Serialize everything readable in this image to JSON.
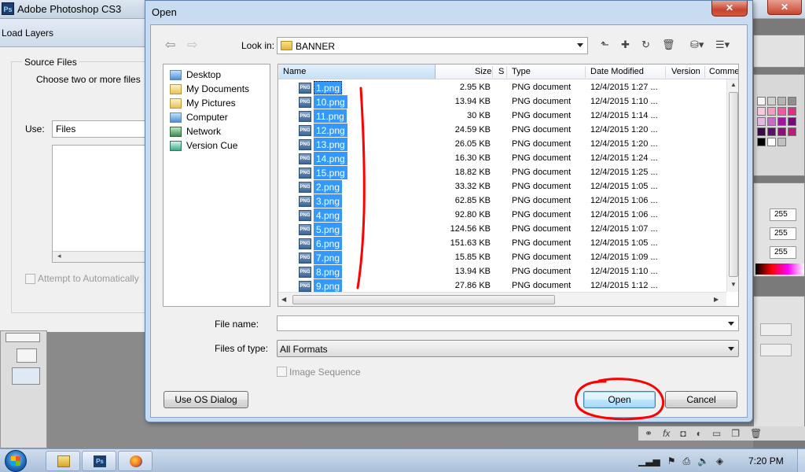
{
  "photoshop": {
    "title": "Adobe Photoshop CS3",
    "logo": "Ps",
    "close_glyph": "✕"
  },
  "load_layers": {
    "title": "Load Layers",
    "group_label": "Source Files",
    "instruction": "Choose two or more files",
    "use_label": "Use:",
    "use_value": "Files",
    "checkbox_label": "Attempt to Automatically"
  },
  "right_panel": {
    "values": [
      "255",
      "255",
      "255"
    ],
    "swatch_colors": [
      "#f6f6f6",
      "#d0d0d0",
      "#b3b3b3",
      "#8f8f8f",
      "#f9c9e0",
      "#f69ac4",
      "#ef5aa5",
      "#e62a87",
      "#e3b8e1",
      "#c96ac9",
      "#a1169e",
      "#760a7b",
      "#3a0b47",
      "#5c0f68",
      "#8a0f78",
      "#c2187a",
      "#000000",
      "#ffffff",
      "#c0c0c0"
    ]
  },
  "dialog": {
    "title": "Open",
    "close_glyph": "✕",
    "look_in_label": "Look in:",
    "look_in_value": "BANNER",
    "places": [
      {
        "label": "Desktop",
        "icon": "desktop-icon"
      },
      {
        "label": "My Documents",
        "icon": "documents-icon"
      },
      {
        "label": "My Pictures",
        "icon": "pictures-icon"
      },
      {
        "label": "Computer",
        "icon": "computer-icon"
      },
      {
        "label": "Network",
        "icon": "network-icon"
      },
      {
        "label": "Version Cue",
        "icon": "version-cue-icon"
      }
    ],
    "columns": {
      "name": "Name",
      "size": "Size",
      "s": "S",
      "type": "Type",
      "date": "Date Modified",
      "version": "Version",
      "comments": "Comme"
    },
    "files": [
      {
        "name": "1.png",
        "size": "2.95 KB",
        "type": "PNG document",
        "date": "12/4/2015 1:27 ..."
      },
      {
        "name": "10.png",
        "size": "13.94 KB",
        "type": "PNG document",
        "date": "12/4/2015 1:10 ..."
      },
      {
        "name": "11.png",
        "size": "30 KB",
        "type": "PNG document",
        "date": "12/4/2015 1:14 ..."
      },
      {
        "name": "12.png",
        "size": "24.59 KB",
        "type": "PNG document",
        "date": "12/4/2015 1:20 ..."
      },
      {
        "name": "13.png",
        "size": "26.05 KB",
        "type": "PNG document",
        "date": "12/4/2015 1:20 ..."
      },
      {
        "name": "14.png",
        "size": "16.30 KB",
        "type": "PNG document",
        "date": "12/4/2015 1:24 ..."
      },
      {
        "name": "15.png",
        "size": "18.82 KB",
        "type": "PNG document",
        "date": "12/4/2015 1:25 ..."
      },
      {
        "name": "2.png",
        "size": "33.32 KB",
        "type": "PNG document",
        "date": "12/4/2015 1:05 ..."
      },
      {
        "name": "3.png",
        "size": "62.85 KB",
        "type": "PNG document",
        "date": "12/4/2015 1:06 ..."
      },
      {
        "name": "4.png",
        "size": "92.80 KB",
        "type": "PNG document",
        "date": "12/4/2015 1:06 ..."
      },
      {
        "name": "5.png",
        "size": "124.56 KB",
        "type": "PNG document",
        "date": "12/4/2015 1:07 ..."
      },
      {
        "name": "6.png",
        "size": "151.63 KB",
        "type": "PNG document",
        "date": "12/4/2015 1:05 ..."
      },
      {
        "name": "7.png",
        "size": "15.85 KB",
        "type": "PNG document",
        "date": "12/4/2015 1:09 ..."
      },
      {
        "name": "8.png",
        "size": "13.94 KB",
        "type": "PNG document",
        "date": "12/4/2015 1:10 ..."
      },
      {
        "name": "9.png",
        "size": "27.86 KB",
        "type": "PNG document",
        "date": "12/4/2015 1:12 ..."
      }
    ],
    "file_icon_text": "PNG",
    "file_name_label": "File name:",
    "file_name_value": "",
    "files_of_type_label": "Files of type:",
    "files_of_type_value": "All Formats",
    "image_sequence_label": "Image Sequence",
    "use_os_dialog_label": "Use OS Dialog",
    "open_label": "Open",
    "cancel_label": "Cancel"
  },
  "taskbar": {
    "time": "7:20 PM",
    "ps_icon_text": "Ps"
  },
  "annotation": {
    "color": "#ff0000"
  }
}
